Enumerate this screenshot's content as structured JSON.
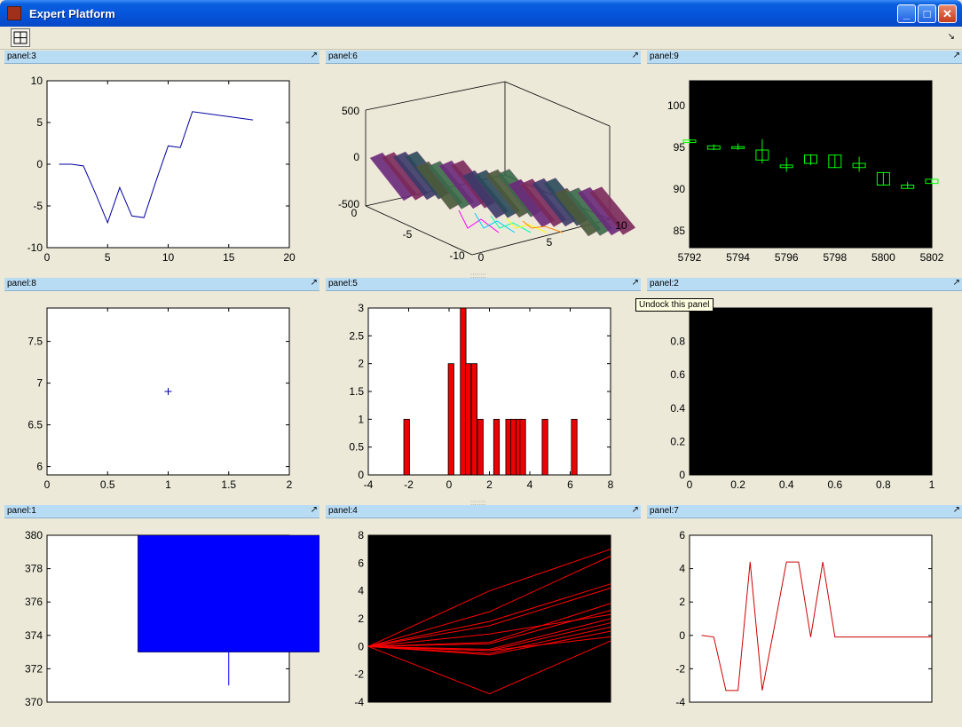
{
  "window": {
    "title": "Expert Platform",
    "min": "_",
    "max": "□",
    "close": "✕"
  },
  "toolbar": {
    "corner": "↘"
  },
  "tooltip": "Undock this panel",
  "undock_icon": "↗",
  "panels": {
    "p3": {
      "title": "panel:3"
    },
    "p6": {
      "title": "panel:6"
    },
    "p9": {
      "title": "panel:9"
    },
    "p8": {
      "title": "panel:8"
    },
    "p5": {
      "title": "panel:5"
    },
    "p2": {
      "title": "panel:2"
    },
    "p1": {
      "title": "panel:1"
    },
    "p4": {
      "title": "panel:4"
    },
    "p7": {
      "title": "panel:7"
    }
  },
  "chart_data": [
    {
      "panel": "p3",
      "type": "line",
      "color": "#0000a0",
      "bg": "#ffffff",
      "xlim": [
        0,
        20
      ],
      "ylim": [
        -10,
        10
      ],
      "xticks": [
        "0",
        "5",
        "10",
        "15",
        "20"
      ],
      "yticks": [
        "-10",
        "-5",
        "0",
        "5",
        "10"
      ],
      "x": [
        1,
        2,
        3,
        4,
        5,
        6,
        7,
        8,
        9,
        10,
        11,
        12,
        17
      ],
      "y": [
        0,
        0,
        -0.2,
        -3.5,
        -7,
        -2.8,
        -6.2,
        -6.4,
        -2,
        2.2,
        2,
        6.3,
        5.3
      ]
    },
    {
      "panel": "p6",
      "type": "surface3d",
      "zticks": [
        "500",
        "0",
        "-500"
      ],
      "yticks": [
        "0",
        "-5",
        "-10"
      ],
      "xticks": [
        "0",
        "5",
        "10"
      ]
    },
    {
      "panel": "p9",
      "type": "candlestick",
      "color": "#00ff00",
      "bg": "#000000",
      "xlim": [
        5792,
        5802
      ],
      "ylim": [
        83,
        103
      ],
      "xticks": [
        "5792",
        "5794",
        "5796",
        "5798",
        "5800",
        "5802"
      ],
      "yticks": [
        "85",
        "90",
        "95",
        "100"
      ],
      "candles": [
        {
          "x": 5792,
          "o": 95.6,
          "c": 95.9,
          "h": 96.0,
          "l": 95.5
        },
        {
          "x": 5793,
          "o": 94.8,
          "c": 95.2,
          "h": 95.4,
          "l": 94.7
        },
        {
          "x": 5794,
          "o": 95.0,
          "c": 95.1,
          "h": 95.5,
          "l": 94.7
        },
        {
          "x": 5795,
          "o": 93.5,
          "c": 94.7,
          "h": 96.0,
          "l": 93.1
        },
        {
          "x": 5796,
          "o": 92.6,
          "c": 92.9,
          "h": 93.8,
          "l": 92.1
        },
        {
          "x": 5797,
          "o": 93.1,
          "c": 94.1,
          "h": 94.2,
          "l": 92.9
        },
        {
          "x": 5798,
          "o": 92.6,
          "c": 94.1,
          "h": 94.1,
          "l": 92.6
        },
        {
          "x": 5799,
          "o": 92.6,
          "c": 93.1,
          "h": 93.9,
          "l": 92.1
        },
        {
          "x": 5800,
          "o": 90.5,
          "c": 92.0,
          "h": 92.0,
          "l": 90.5
        },
        {
          "x": 5801,
          "o": 90.1,
          "c": 90.5,
          "h": 90.9,
          "l": 90.1
        },
        {
          "x": 5802,
          "o": 90.7,
          "c": 91.2,
          "h": 91.2,
          "l": 90.7
        }
      ]
    },
    {
      "panel": "p8",
      "type": "scatter",
      "color": "#0000a0",
      "bg": "#ffffff",
      "xlim": [
        0,
        2
      ],
      "ylim": [
        5.9,
        7.9
      ],
      "xticks": [
        "0",
        "0.5",
        "1",
        "1.5",
        "2"
      ],
      "yticks": [
        "6",
        "6.5",
        "7",
        "7.5"
      ],
      "points": [
        [
          1,
          6.9
        ]
      ]
    },
    {
      "panel": "p5",
      "type": "bar",
      "color": "#ee0000",
      "bg": "#ffffff",
      "xlim": [
        -4,
        8
      ],
      "ylim": [
        0,
        3
      ],
      "xticks": [
        "-4",
        "-2",
        "0",
        "2",
        "4",
        "6",
        "8"
      ],
      "yticks": [
        "0",
        "0.5",
        "1",
        "1.5",
        "2",
        "2.5",
        "3"
      ],
      "bars": [
        [
          -2.1,
          1
        ],
        [
          0.1,
          2
        ],
        [
          0.7,
          3
        ],
        [
          0.95,
          2
        ],
        [
          1.25,
          2
        ],
        [
          1.55,
          1
        ],
        [
          2.35,
          1
        ],
        [
          2.95,
          1
        ],
        [
          3.2,
          1
        ],
        [
          3.45,
          1
        ],
        [
          3.65,
          1
        ],
        [
          4.75,
          1
        ],
        [
          6.2,
          1
        ]
      ],
      "barwidth": 0.28
    },
    {
      "panel": "p2",
      "type": "empty",
      "bg": "#000000",
      "xlim": [
        0,
        1
      ],
      "ylim": [
        0,
        1
      ],
      "xticks": [
        "0",
        "0.2",
        "0.4",
        "0.6",
        "0.8",
        "1"
      ],
      "yticks": [
        "0",
        "0.2",
        "0.4",
        "0.6",
        "0.8"
      ]
    },
    {
      "panel": "p1",
      "type": "boxbar",
      "color": "#0000ff",
      "bg": "#ffffff",
      "xlim": [
        0,
        2
      ],
      "ylim": [
        370,
        380
      ],
      "yticks": [
        "370",
        "372",
        "374",
        "376",
        "378",
        "380"
      ],
      "bar": {
        "x0": 0.75,
        "x1": 2.25,
        "top": 380,
        "bottom": 373
      },
      "stem": {
        "x": 1.5,
        "from": 373,
        "to": 371
      }
    },
    {
      "panel": "p4",
      "type": "lines",
      "color": "#ff0000",
      "bg": "#000000",
      "xlim": [
        0,
        10
      ],
      "ylim": [
        -4,
        8
      ],
      "yticks": [
        "-4",
        "-2",
        "0",
        "2",
        "4",
        "6",
        "8"
      ],
      "series": [
        {
          "y": [
            0,
            4,
            7
          ]
        },
        {
          "y": [
            0,
            2.5,
            6.5
          ]
        },
        {
          "y": [
            0,
            1.8,
            4.5
          ]
        },
        {
          "y": [
            0,
            1.5,
            4.2
          ]
        },
        {
          "y": [
            0,
            0.9,
            2.3
          ]
        },
        {
          "y": [
            0,
            0.3,
            3.1
          ]
        },
        {
          "y": [
            0,
            0.2,
            2.6
          ]
        },
        {
          "y": [
            0,
            -0.2,
            2.0
          ]
        },
        {
          "y": [
            0,
            -0.3,
            1.7
          ]
        },
        {
          "y": [
            0,
            -0.5,
            1.4
          ]
        },
        {
          "y": [
            0,
            -0.6,
            1.1
          ]
        },
        {
          "y": [
            0,
            -0.3,
            0.7
          ]
        },
        {
          "y": [
            0,
            -3.4,
            0.4
          ]
        }
      ]
    },
    {
      "panel": "p7",
      "type": "line",
      "color": "#cc0000",
      "bg": "#ffffff",
      "xlim": [
        0,
        20
      ],
      "ylim": [
        -4,
        6
      ],
      "yticks": [
        "-4",
        "-2",
        "0",
        "2",
        "4",
        "6"
      ],
      "x": [
        1,
        2,
        3,
        4,
        5,
        6,
        7,
        8,
        9,
        10,
        11,
        12,
        13,
        14,
        15,
        16,
        17,
        18,
        19,
        20
      ],
      "y": [
        0,
        -0.1,
        -3.3,
        -3.3,
        4.4,
        -3.3,
        0.5,
        4.4,
        4.4,
        -0.1,
        4.4,
        -0.1,
        -0.1,
        -0.1,
        -0.1,
        -0.1,
        -0.1,
        -0.1,
        -0.1,
        -0.1
      ]
    }
  ]
}
